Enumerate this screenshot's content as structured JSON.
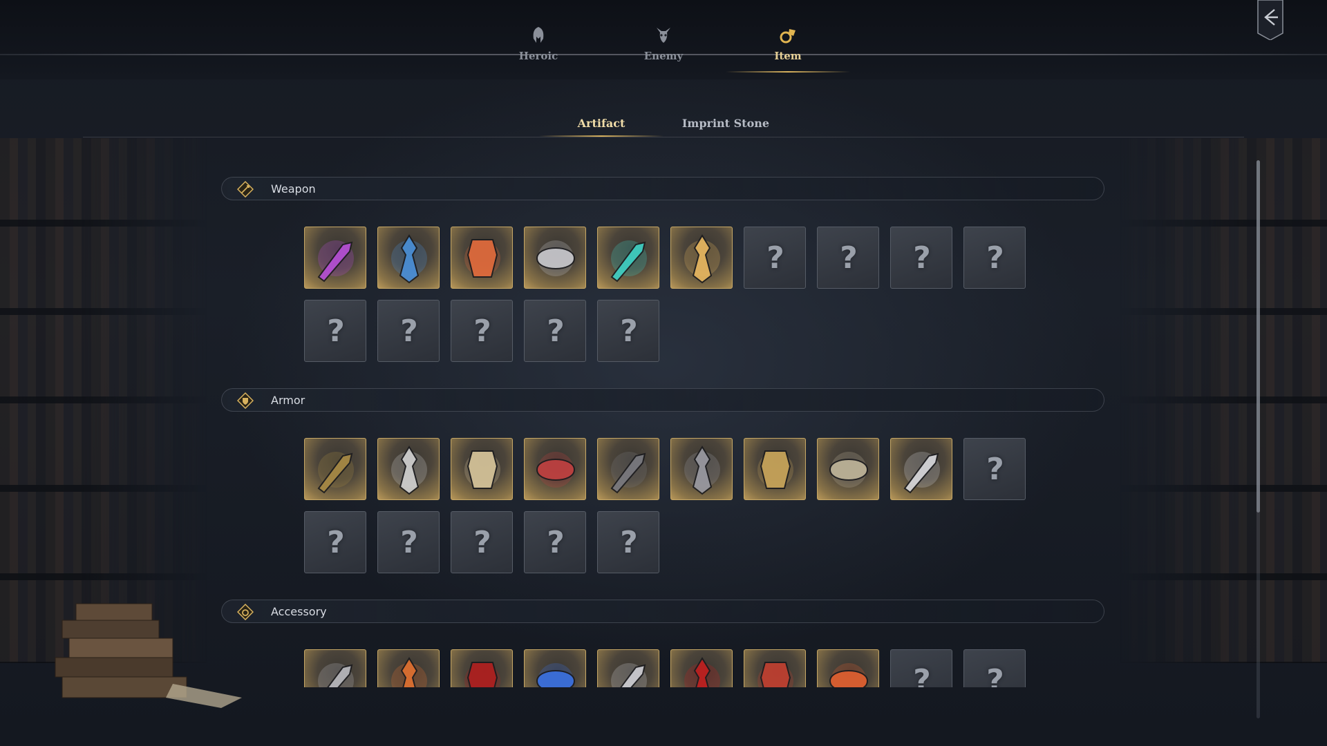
{
  "top_tabs": [
    {
      "label": "Heroic",
      "icon": "helmet-icon"
    },
    {
      "label": "Enemy",
      "icon": "demon-icon"
    },
    {
      "label": "Item",
      "icon": "item-bag-icon",
      "active": true
    }
  ],
  "sub_tabs": [
    {
      "label": "Artifact",
      "active": true
    },
    {
      "label": "Imprint Stone"
    }
  ],
  "sections": [
    {
      "title": "Weapon",
      "icon": "weapon-diamond-icon",
      "tiles": [
        {
          "state": "unlocked",
          "icon": "magic-staff-icon",
          "color": "#b64fd6"
        },
        {
          "state": "unlocked",
          "icon": "blue-axe-icon",
          "color": "#4a8fd8"
        },
        {
          "state": "unlocked",
          "icon": "flame-blade-icon",
          "color": "#e26b3c"
        },
        {
          "state": "unlocked",
          "icon": "claw-gauntlet-icon",
          "color": "#c8c8cc"
        },
        {
          "state": "unlocked",
          "icon": "crossed-daggers-icon",
          "color": "#3fd0c4"
        },
        {
          "state": "unlocked",
          "icon": "golden-sword-icon",
          "color": "#e8b760"
        },
        {
          "state": "locked",
          "icon": "question-mark-icon",
          "label": "?"
        },
        {
          "state": "locked",
          "icon": "question-mark-icon",
          "label": "?"
        },
        {
          "state": "locked",
          "icon": "question-mark-icon",
          "label": "?"
        },
        {
          "state": "locked",
          "icon": "question-mark-icon",
          "label": "?"
        },
        {
          "state": "locked",
          "icon": "question-mark-icon",
          "label": "?"
        },
        {
          "state": "locked",
          "icon": "question-mark-icon",
          "label": "?"
        },
        {
          "state": "locked",
          "icon": "question-mark-icon",
          "label": "?"
        },
        {
          "state": "locked",
          "icon": "question-mark-icon",
          "label": "?"
        },
        {
          "state": "locked",
          "icon": "question-mark-icon",
          "label": "?"
        }
      ]
    },
    {
      "title": "Armor",
      "icon": "armor-diamond-icon",
      "tiles": [
        {
          "state": "unlocked",
          "icon": "thorn-chestplate-icon",
          "color": "#a88a45"
        },
        {
          "state": "unlocked",
          "icon": "bloody-mask-icon",
          "color": "#d0d0d0"
        },
        {
          "state": "unlocked",
          "icon": "bishop-robe-icon",
          "color": "#d6c49a"
        },
        {
          "state": "unlocked",
          "icon": "spiked-crown-icon",
          "color": "#c04040"
        },
        {
          "state": "unlocked",
          "icon": "dark-gauntlet-icon",
          "color": "#7a7a80"
        },
        {
          "state": "unlocked",
          "icon": "knight-helm-icon",
          "color": "#9a9aa2"
        },
        {
          "state": "unlocked",
          "icon": "golden-glove-icon",
          "color": "#c9a55a"
        },
        {
          "state": "unlocked",
          "icon": "spiked-pauldron-icon",
          "color": "#bfb59a"
        },
        {
          "state": "unlocked",
          "icon": "hooded-mantle-icon",
          "color": "#d8d8dc"
        },
        {
          "state": "locked",
          "icon": "question-mark-icon",
          "label": "?"
        },
        {
          "state": "locked",
          "icon": "question-mark-icon",
          "label": "?"
        },
        {
          "state": "locked",
          "icon": "question-mark-icon",
          "label": "?"
        },
        {
          "state": "locked",
          "icon": "question-mark-icon",
          "label": "?"
        },
        {
          "state": "locked",
          "icon": "question-mark-icon",
          "label": "?"
        },
        {
          "state": "locked",
          "icon": "question-mark-icon",
          "label": "?"
        }
      ]
    },
    {
      "title": "Accessory",
      "icon": "accessory-diamond-icon",
      "tiles": [
        {
          "state": "unlocked",
          "icon": "hood-icon",
          "color": "#b8b8be"
        },
        {
          "state": "unlocked",
          "icon": "ruby-ring-icon",
          "color": "#e07030"
        },
        {
          "state": "unlocked",
          "icon": "red-banner-icon",
          "color": "#b02020"
        },
        {
          "state": "unlocked",
          "icon": "blue-orb-icon",
          "color": "#3a70e0"
        },
        {
          "state": "unlocked",
          "icon": "silver-ring-icon",
          "color": "#cfcfd4"
        },
        {
          "state": "unlocked",
          "icon": "red-eye-icon",
          "color": "#c02020"
        },
        {
          "state": "unlocked",
          "icon": "chain-icon",
          "color": "#c04030"
        },
        {
          "state": "unlocked",
          "icon": "fire-scroll-icon",
          "color": "#e06030"
        },
        {
          "state": "locked",
          "icon": "question-mark-icon",
          "label": "?"
        },
        {
          "state": "locked",
          "icon": "question-mark-icon",
          "label": "?"
        }
      ]
    }
  ],
  "colors": {
    "accent_gold": "#d8b25e",
    "active_text": "#e6cf95",
    "background": "#161a22"
  },
  "back_button": {
    "icon": "back-arrow-icon"
  }
}
